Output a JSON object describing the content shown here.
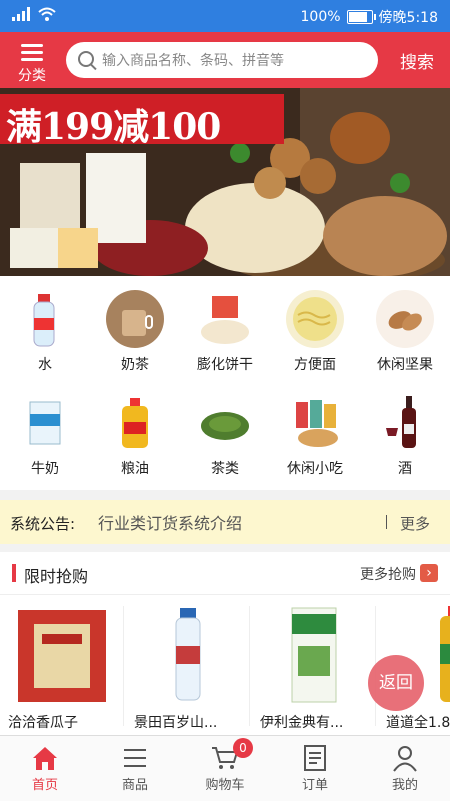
{
  "status_bar": {
    "battery": "100%",
    "time": "傍晚5:18"
  },
  "header": {
    "category_label": "分类",
    "search_placeholder": "输入商品名称、条码、拼音等",
    "search_button": "搜索"
  },
  "banner": {
    "promo_text": "满199减100"
  },
  "categories": [
    {
      "label": "水"
    },
    {
      "label": "奶茶"
    },
    {
      "label": "膨化饼干"
    },
    {
      "label": "方便面"
    },
    {
      "label": "休闲坚果"
    },
    {
      "label": "牛奶"
    },
    {
      "label": "粮油"
    },
    {
      "label": "茶类"
    },
    {
      "label": "休闲小吃"
    },
    {
      "label": "酒"
    }
  ],
  "notice": {
    "title": "系统公告:",
    "text": "行业类订货系统介绍",
    "more": "更多"
  },
  "flash_sale": {
    "title": "限时抢购",
    "more": "更多抢购",
    "products": [
      {
        "name": "洽洽香瓜子"
      },
      {
        "name": "景田百岁山..."
      },
      {
        "name": "伊利金典有..."
      },
      {
        "name": "道道全1.8"
      }
    ]
  },
  "floating": {
    "back_label": "返回"
  },
  "tabbar": [
    {
      "label": "首页"
    },
    {
      "label": "商品"
    },
    {
      "label": "购物车",
      "badge": "0"
    },
    {
      "label": "订单"
    },
    {
      "label": "我的"
    }
  ],
  "colors": {
    "brand_red": "#e63945",
    "status_blue": "#2f7fe0"
  }
}
